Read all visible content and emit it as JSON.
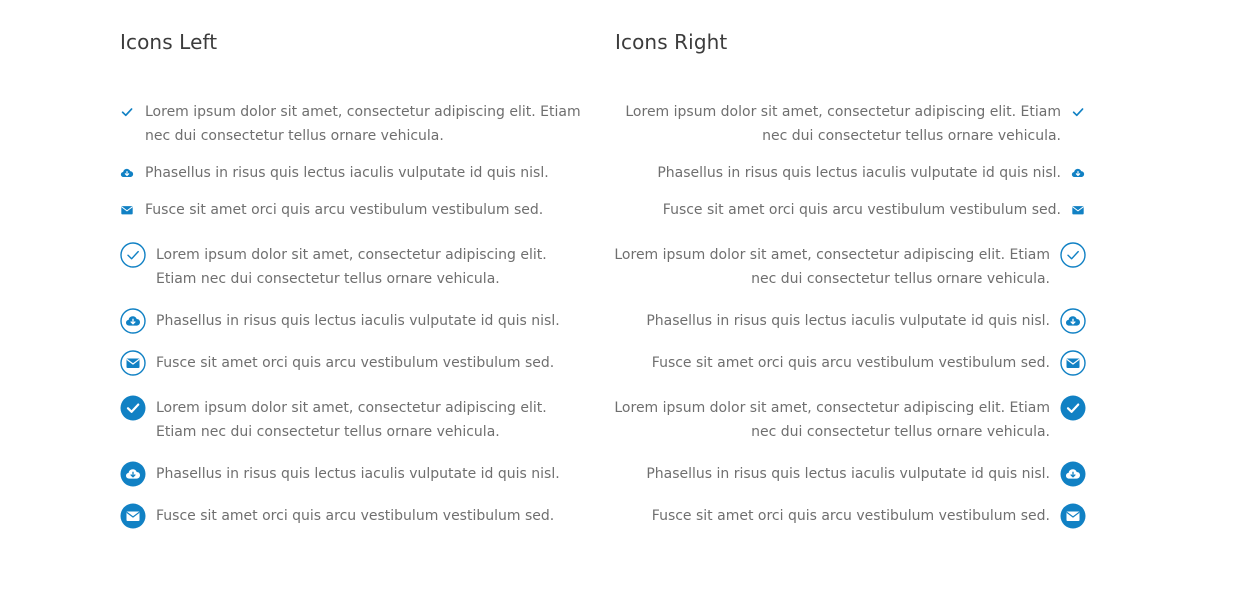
{
  "accent": "#1181c4",
  "left": {
    "title": "Icons Left",
    "groups": [
      {
        "style": "plain",
        "items": [
          {
            "icon": "check-icon",
            "text": "Lorem ipsum dolor sit amet, consectetur adipiscing elit. Etiam nec dui consectetur tellus ornare vehicula."
          },
          {
            "icon": "cloud-download-icon",
            "text": "Phasellus in risus quis lectus iaculis vulputate id quis nisl."
          },
          {
            "icon": "envelope-icon",
            "text": "Fusce sit amet orci quis arcu vestibulum vestibulum sed."
          }
        ]
      },
      {
        "style": "outline-circle",
        "items": [
          {
            "icon": "check-icon",
            "text": "Lorem ipsum dolor sit amet, consectetur adipiscing elit. Etiam nec dui consectetur tellus ornare vehicula."
          },
          {
            "icon": "cloud-download-icon",
            "text": "Phasellus in risus quis lectus iaculis vulputate id quis nisl."
          },
          {
            "icon": "envelope-icon",
            "text": "Fusce sit amet orci quis arcu vestibulum vestibulum sed."
          }
        ]
      },
      {
        "style": "filled-circle",
        "items": [
          {
            "icon": "check-icon",
            "text": "Lorem ipsum dolor sit amet, consectetur adipiscing elit. Etiam nec dui consectetur tellus ornare vehicula."
          },
          {
            "icon": "cloud-download-icon",
            "text": "Phasellus in risus quis lectus iaculis vulputate id quis nisl."
          },
          {
            "icon": "envelope-icon",
            "text": "Fusce sit amet orci quis arcu vestibulum vestibulum sed."
          }
        ]
      }
    ]
  },
  "right": {
    "title": "Icons Right",
    "groups": [
      {
        "style": "plain",
        "items": [
          {
            "icon": "check-icon",
            "text": "Lorem ipsum dolor sit amet, consectetur adipiscing elit. Etiam nec dui consectetur tellus ornare vehicula."
          },
          {
            "icon": "cloud-download-icon",
            "text": "Phasellus in risus quis lectus iaculis vulputate id quis nisl."
          },
          {
            "icon": "envelope-icon",
            "text": "Fusce sit amet orci quis arcu vestibulum vestibulum sed."
          }
        ]
      },
      {
        "style": "outline-circle",
        "items": [
          {
            "icon": "check-icon",
            "text": "Lorem ipsum dolor sit amet, consectetur adipiscing elit. Etiam nec dui consectetur tellus ornare vehicula."
          },
          {
            "icon": "cloud-download-icon",
            "text": "Phasellus in risus quis lectus iaculis vulputate id quis nisl."
          },
          {
            "icon": "envelope-icon",
            "text": "Fusce sit amet orci quis arcu vestibulum vestibulum sed."
          }
        ]
      },
      {
        "style": "filled-circle",
        "items": [
          {
            "icon": "check-icon",
            "text": "Lorem ipsum dolor sit amet, consectetur adipiscing elit. Etiam nec dui consectetur tellus ornare vehicula."
          },
          {
            "icon": "cloud-download-icon",
            "text": "Phasellus in risus quis lectus iaculis vulputate id quis nisl."
          },
          {
            "icon": "envelope-icon",
            "text": "Fusce sit amet orci quis arcu vestibulum vestibulum sed."
          }
        ]
      }
    ]
  }
}
